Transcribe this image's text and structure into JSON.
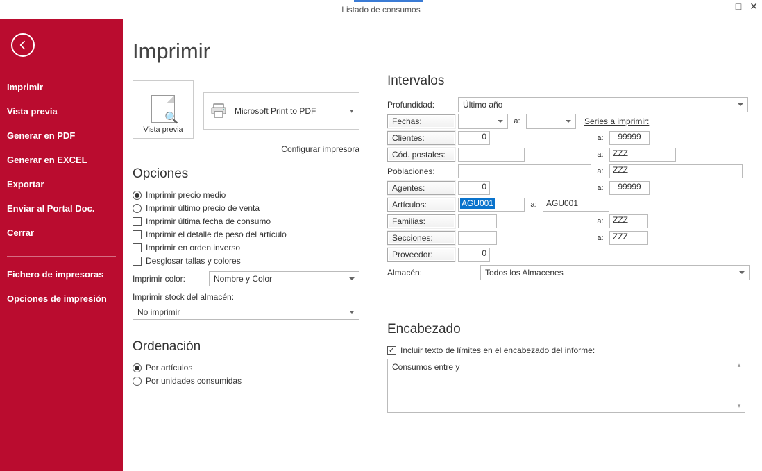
{
  "window": {
    "title": "Listado de consumos"
  },
  "sidebar": {
    "items": [
      "Imprimir",
      "Vista previa",
      "Generar en PDF",
      "Generar en EXCEL",
      "Exportar",
      "Enviar al Portal Doc.",
      "Cerrar"
    ],
    "items2": [
      "Fichero de impresoras",
      "Opciones de impresión"
    ]
  },
  "page": {
    "title": "Imprimir"
  },
  "preview": {
    "label": "Vista previa",
    "printer": "Microsoft Print to PDF",
    "config_link": "Configurar impresora"
  },
  "options": {
    "title": "Opciones",
    "radio1": "Imprimir precio medio",
    "radio2": "Imprimir último precio de venta",
    "chk1": "Imprimir última fecha de consumo",
    "chk2": "Imprimir el detalle de peso del artículo",
    "chk3": "Imprimir en orden inverso",
    "chk4": "Desglosar tallas y colores",
    "color_label": "Imprimir color:",
    "color_value": "Nombre y Color",
    "stock_label": "Imprimir stock del almacén:",
    "stock_value": "No imprimir"
  },
  "order": {
    "title": "Ordenación",
    "r1": "Por artículos",
    "r2": "Por unidades consumidas"
  },
  "intervals": {
    "title": "Intervalos",
    "profundidad_label": "Profundidad:",
    "profundidad_value": "Último año",
    "fechas_label": "Fechas:",
    "a": "a:",
    "series_link": "Series a imprimir:",
    "clientes_label": "Clientes:",
    "clientes_from": "0",
    "clientes_to": "99999",
    "cp_label": "Cód. postales:",
    "cp_from": "",
    "cp_to": "ZZZ",
    "pobl_label": "Poblaciones:",
    "pobl_from": "",
    "pobl_to": "ZZZ",
    "agentes_label": "Agentes:",
    "agentes_from": "0",
    "agentes_to": "99999",
    "articulos_label": "Artículos:",
    "articulos_from": "AGU001",
    "articulos_to": "AGU001",
    "familias_label": "Familias:",
    "familias_from": "",
    "familias_to": "ZZZ",
    "secciones_label": "Secciones:",
    "secciones_from": "",
    "secciones_to": "ZZZ",
    "proveedor_label": "Proveedor:",
    "proveedor_from": "0",
    "almacen_label": "Almacén:",
    "almacen_value": "Todos los Almacenes"
  },
  "header_section": {
    "title": "Encabezado",
    "chk": "Incluir texto de límites en el encabezado del informe:",
    "text": "Consumos entre  y"
  }
}
